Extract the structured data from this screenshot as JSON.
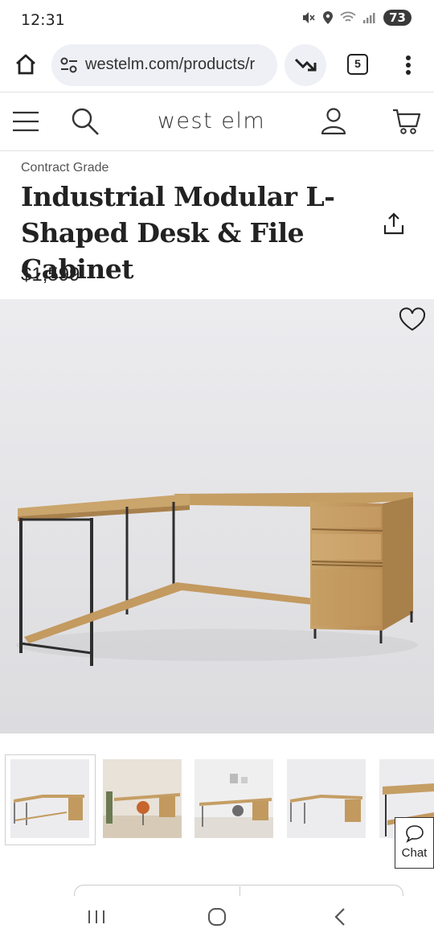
{
  "status_bar": {
    "time": "12:31",
    "battery": "73",
    "icons": [
      "mute-icon",
      "location-icon",
      "wifi-icon",
      "signal-icon"
    ]
  },
  "browser": {
    "url": "westelm.com/products/r",
    "tab_count": "5",
    "icons": [
      "home-icon",
      "tune-icon",
      "trending-icon",
      "more-vert-icon"
    ]
  },
  "site_header": {
    "brand": "west elm",
    "icons": [
      "menu-icon",
      "search-icon",
      "account-icon",
      "cart-icon"
    ]
  },
  "product": {
    "brand_line": "Contract Grade",
    "title": "Industrial Modular L-Shaped Desk & File Cabinet",
    "price": "$1,599"
  },
  "gallery": {
    "thumbnail_count": 5,
    "selected_index": 0
  },
  "chat": {
    "label": "Chat"
  },
  "colors": {
    "hero_background": "#e9e9ec",
    "wood": "#c9a46b",
    "metal": "#2e2e2e",
    "url_pill": "#eef0f6"
  }
}
